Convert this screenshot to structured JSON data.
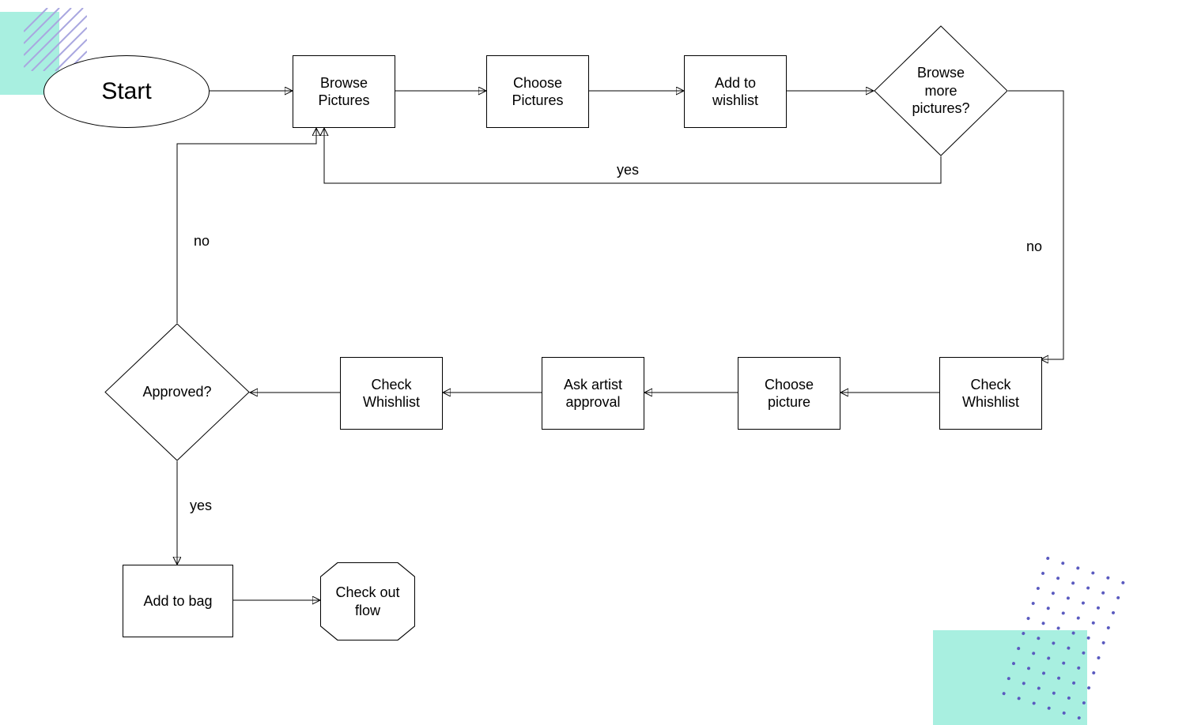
{
  "decor": {
    "accent": "#a8efe0",
    "hatch_color": "#a9a7e0",
    "dots_color": "#5a5abf"
  },
  "nodes": {
    "start": {
      "label": "Start",
      "type": "ellipse"
    },
    "browse_pictures": {
      "label": "Browse\nPictures",
      "type": "rect"
    },
    "choose_pictures": {
      "label": "Choose\nPictures",
      "type": "rect"
    },
    "add_to_wishlist": {
      "label": "Add to\nwishlist",
      "type": "rect"
    },
    "browse_more": {
      "label": "Browse\nmore\npictures?",
      "type": "diamond"
    },
    "check_wishlist_1": {
      "label": "Check\nWhishlist",
      "type": "rect"
    },
    "choose_picture": {
      "label": "Choose\npicture",
      "type": "rect"
    },
    "ask_artist": {
      "label": "Ask artist\napproval",
      "type": "rect"
    },
    "check_wishlist_2": {
      "label": "Check\nWhishlist",
      "type": "rect"
    },
    "approved": {
      "label": "Approved?",
      "type": "diamond"
    },
    "add_to_bag": {
      "label": "Add to bag",
      "type": "rect"
    },
    "checkout": {
      "label": "Check out\nflow",
      "type": "octagon"
    }
  },
  "edge_labels": {
    "browse_more_yes": "yes",
    "browse_more_no": "no",
    "approved_no": "no",
    "approved_yes": "yes"
  },
  "edges": [
    {
      "from": "start",
      "to": "browse_pictures"
    },
    {
      "from": "browse_pictures",
      "to": "choose_pictures"
    },
    {
      "from": "choose_pictures",
      "to": "add_to_wishlist"
    },
    {
      "from": "add_to_wishlist",
      "to": "browse_more"
    },
    {
      "from": "browse_more",
      "to": "browse_pictures",
      "label": "yes"
    },
    {
      "from": "browse_more",
      "to": "check_wishlist_1",
      "label": "no"
    },
    {
      "from": "check_wishlist_1",
      "to": "choose_picture"
    },
    {
      "from": "choose_picture",
      "to": "ask_artist"
    },
    {
      "from": "ask_artist",
      "to": "check_wishlist_2"
    },
    {
      "from": "check_wishlist_2",
      "to": "approved"
    },
    {
      "from": "approved",
      "to": "browse_pictures",
      "label": "no"
    },
    {
      "from": "approved",
      "to": "add_to_bag",
      "label": "yes"
    },
    {
      "from": "add_to_bag",
      "to": "checkout"
    }
  ]
}
